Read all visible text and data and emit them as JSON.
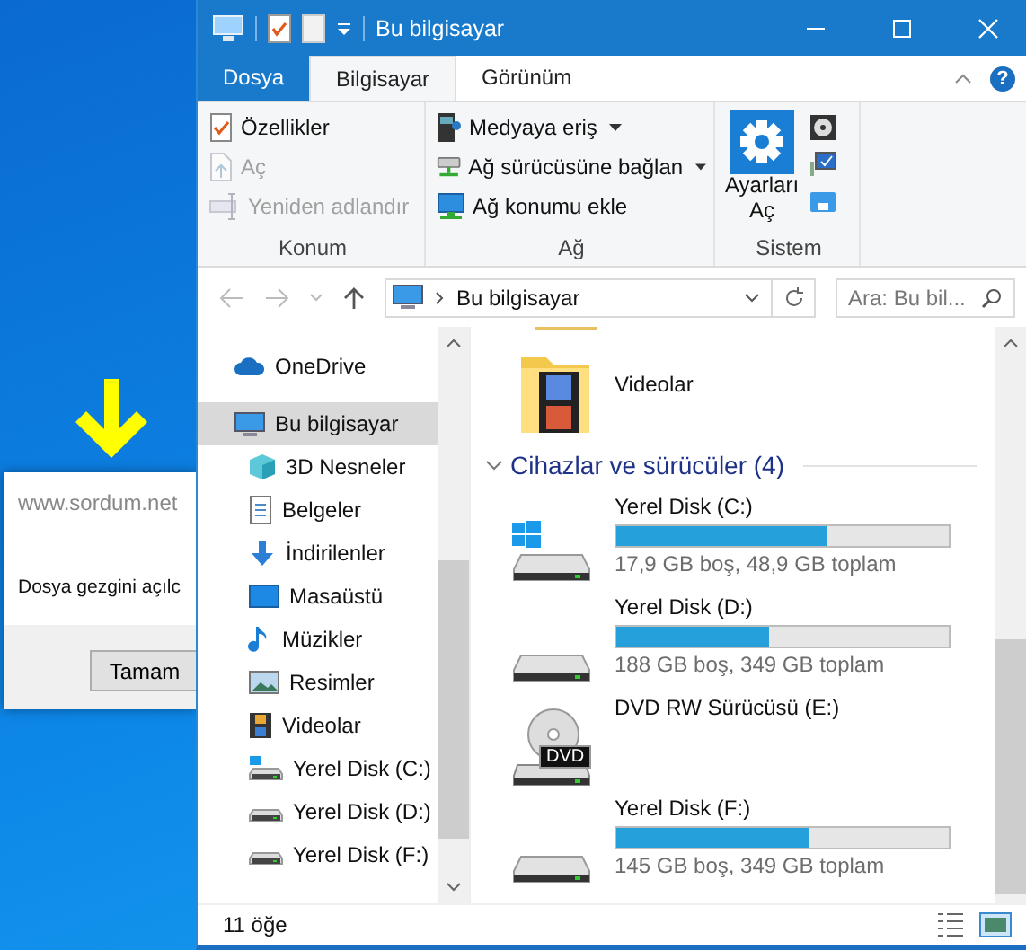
{
  "desktop": {
    "dialog": {
      "title": "www.sordum.net",
      "message": "Dosya gezgini açılc",
      "button": "Tamam"
    }
  },
  "window": {
    "title": "Bu bilgisayar"
  },
  "ribbon": {
    "tabs": [
      {
        "label": "Dosya",
        "kind": "file",
        "selected": false
      },
      {
        "label": "Bilgisayar",
        "kind": "tab",
        "selected": true
      },
      {
        "label": "Görünüm",
        "kind": "tab",
        "selected": false
      }
    ],
    "help": "?",
    "groups": [
      {
        "name": "Konum",
        "commands": [
          {
            "label": "Özellikler",
            "kind": "properties",
            "disabled": false,
            "dropdown": false
          },
          {
            "label": "Aç",
            "kind": "open",
            "disabled": true,
            "dropdown": false
          },
          {
            "label": "Yeniden adlandır",
            "kind": "rename",
            "disabled": true,
            "dropdown": false
          }
        ]
      },
      {
        "name": "Ağ",
        "commands": [
          {
            "label": "Medyaya eriş",
            "kind": "media",
            "disabled": false,
            "dropdown": true
          },
          {
            "label": "Ağ sürücüsüne bağlan",
            "kind": "network-drive",
            "disabled": false,
            "dropdown": true
          },
          {
            "label": "Ağ konumu ekle",
            "kind": "network-location",
            "disabled": false,
            "dropdown": false
          }
        ]
      }
    ],
    "system_group": {
      "name": "Sistem",
      "button": "Ayarları Aç"
    }
  },
  "address": {
    "path": "Bu bilgisayar"
  },
  "search": {
    "placeholder": "Ara: Bu bil..."
  },
  "nav": {
    "items": [
      {
        "label": "OneDrive",
        "kind": "cloud",
        "selected": false
      },
      {
        "label": "Bu bilgisayar",
        "kind": "computer",
        "selected": true,
        "children": [
          {
            "label": "3D Nesneler",
            "kind": "cube",
            "selected": false
          },
          {
            "label": "Belgeler",
            "kind": "document",
            "selected": false
          },
          {
            "label": "İndirilenler",
            "kind": "download",
            "selected": false
          },
          {
            "label": "Masaüstü",
            "kind": "desktop",
            "selected": false
          },
          {
            "label": "Müzikler",
            "kind": "music",
            "selected": false
          },
          {
            "label": "Resimler",
            "kind": "pictures",
            "selected": false
          },
          {
            "label": "Videolar",
            "kind": "videos",
            "selected": false
          },
          {
            "label": "Yerel Disk (C:)",
            "kind": "system-disk",
            "selected": false
          },
          {
            "label": "Yerel Disk (D:)",
            "kind": "disk",
            "selected": false
          },
          {
            "label": "Yerel Disk (F:)",
            "kind": "disk",
            "selected": false
          }
        ]
      }
    ]
  },
  "content": {
    "folders": [
      {
        "name": "Videolar"
      }
    ],
    "group": {
      "title": "Cihazlar ve sürücüler (4)",
      "expanded": true
    },
    "drives": [
      {
        "name": "Yerel Disk (C:)",
        "kind": "system-disk",
        "level": 0.63,
        "space": "17,9 GB boş, 48,9 GB toplam"
      },
      {
        "name": "Yerel Disk (D:)",
        "kind": "disk",
        "level": 0.46,
        "space": "188 GB boş, 349 GB toplam"
      },
      {
        "name": "DVD RW Sürücüsü (E:)",
        "kind": "dvd",
        "label": "DVD"
      },
      {
        "name": "Yerel Disk (F:)",
        "kind": "disk",
        "level": 0.58,
        "space": "145 GB boş, 349 GB toplam"
      }
    ]
  },
  "status_bar": {
    "count": "11 öğe"
  }
}
